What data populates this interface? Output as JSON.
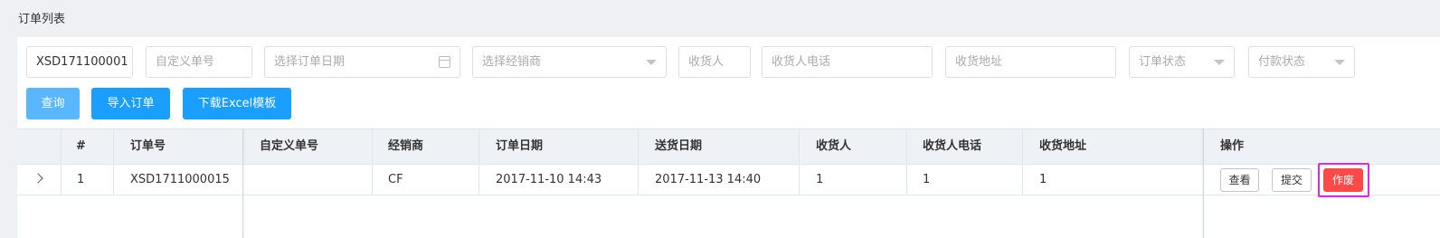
{
  "page": {
    "title": "订单列表"
  },
  "filters": {
    "order_no": {
      "value": "XSD171100001"
    },
    "custom_no": {
      "placeholder": "自定义单号"
    },
    "order_date": {
      "placeholder": "选择订单日期"
    },
    "dealer": {
      "placeholder": "选择经销商"
    },
    "receiver": {
      "placeholder": "收货人"
    },
    "receiver_phone": {
      "placeholder": "收货人电话"
    },
    "receiver_address": {
      "placeholder": "收货地址"
    },
    "order_status": {
      "placeholder": "订单状态"
    },
    "payment_status": {
      "placeholder": "付款状态"
    }
  },
  "actions": {
    "query": "查询",
    "import": "导入订单",
    "download": "下载Excel模板"
  },
  "table": {
    "columns": [
      "#",
      "订单号",
      "自定义单号",
      "经销商",
      "订单日期",
      "送货日期",
      "收货人",
      "收货人电话",
      "收货地址",
      "操作"
    ],
    "rows": [
      {
        "index": "1",
        "order_no": "XSD1711000015",
        "custom_no": "",
        "dealer": "CF",
        "order_date": "2017-11-10 14:43",
        "delivery_date": "2017-11-13 14:40",
        "receiver": "1",
        "receiver_phone": "1",
        "receiver_address": "1",
        "buttons": {
          "view": "查看",
          "submit": "提交",
          "void": "作废"
        }
      }
    ]
  },
  "colors": {
    "primary": "#1a9fff",
    "danger": "#ff4949",
    "highlight": "#e02ae0"
  }
}
